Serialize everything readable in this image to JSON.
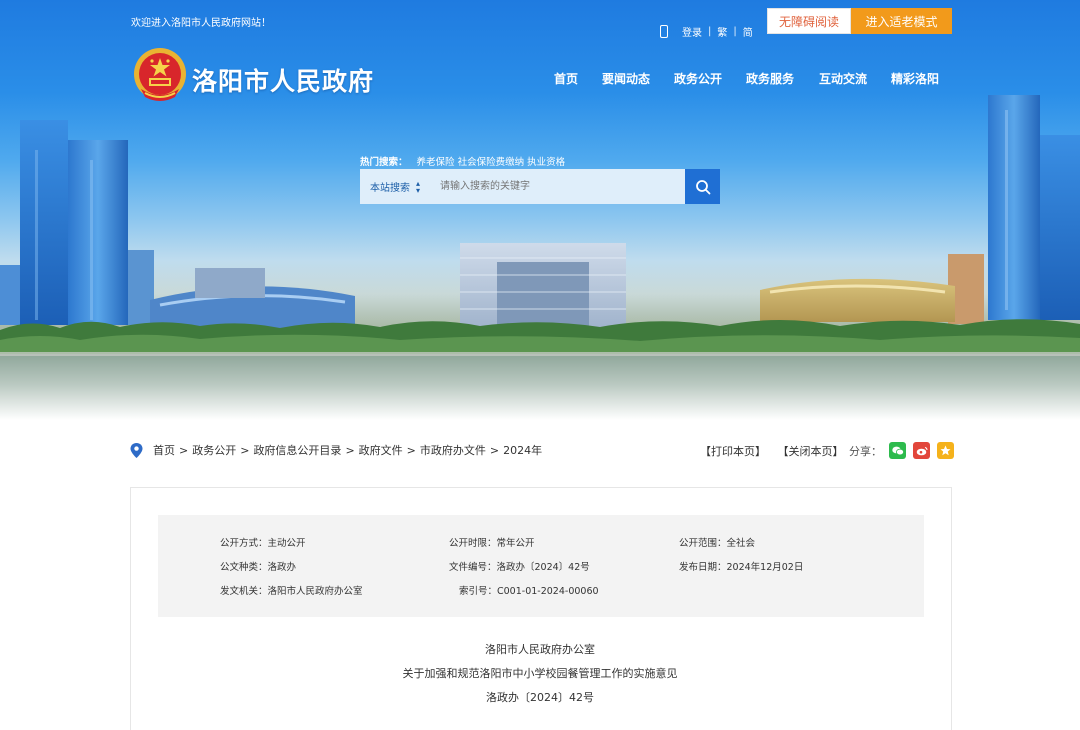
{
  "header": {
    "welcome": "欢迎进入洛阳市人民政府网站！",
    "login": "登录",
    "traditional": "繁",
    "simplified": "简",
    "accessible_reading": "无障碍阅读",
    "elder_mode": "进入适老模式",
    "site_title": "洛阳市人民政府"
  },
  "nav": [
    "首页",
    "要闻动态",
    "政务公开",
    "政务服务",
    "互动交流",
    "精彩洛阳"
  ],
  "search": {
    "hot_label": "热门搜索：",
    "hot_terms": [
      "养老保险",
      "社会保险费缴纳",
      "执业资格"
    ],
    "scope": "本站搜索",
    "placeholder": "请输入搜索的关键字"
  },
  "breadcrumb": [
    "首页",
    "政务公开",
    "政府信息公开目录",
    "政府文件",
    "市政府办文件",
    "2024年"
  ],
  "page_ops": {
    "print": "【打印本页】",
    "close": "【关闭本页】",
    "share_label": "分享："
  },
  "share_icons": [
    "wechat-icon",
    "weibo-icon",
    "qzone-icon"
  ],
  "colors": {
    "accent_blue": "#1f6fd4",
    "elder_orange": "#f29a1b",
    "accessible_text": "#e0623c",
    "wechat": "#2dbb4d",
    "weibo": "#e2463b",
    "qzone": "#f5b21b"
  },
  "metadata": {
    "row1": [
      "公开方式：主动公开",
      "公开时限：常年公开",
      "公开范围：全社会"
    ],
    "row2": [
      "公文种类：洛政办",
      "文件编号：洛政办〔2024〕42号",
      "发布日期：2024年12月02日"
    ],
    "row3": [
      "发文机关：洛阳市人民政府办公室",
      "索引号：C001-01-2024-00060"
    ]
  },
  "document": {
    "issuer": "洛阳市人民政府办公室",
    "title": "关于加强和规范洛阳市中小学校园餐管理工作的实施意见",
    "number": "洛政办〔2024〕42号"
  }
}
